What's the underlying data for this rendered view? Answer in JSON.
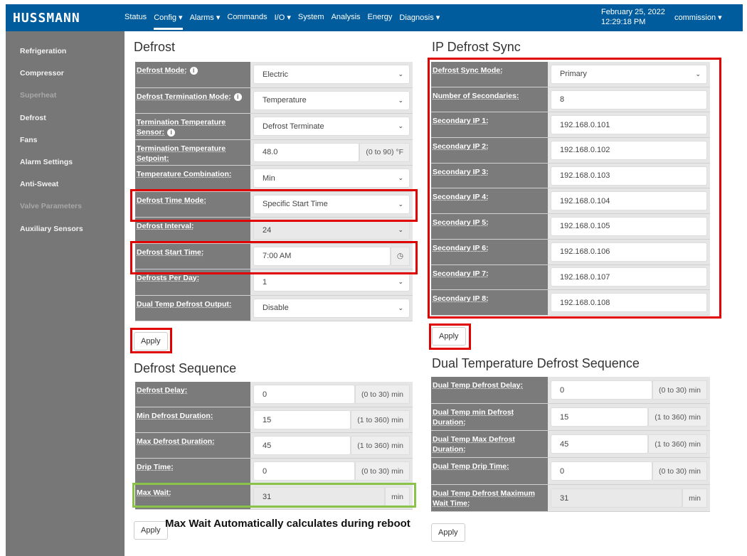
{
  "header": {
    "logo": "HUSSMANN",
    "nav": [
      "Status",
      "Config ▾",
      "Alarms ▾",
      "Commands",
      "I/O ▾",
      "System",
      "Analysis",
      "Energy",
      "Diagnosis ▾"
    ],
    "date": "February 25, 2022",
    "time": "12:29:18 PM",
    "user": "commission ▾"
  },
  "sidebar": [
    {
      "label": "Refrigeration",
      "disabled": false
    },
    {
      "label": "Compressor",
      "disabled": false
    },
    {
      "label": "Superheat",
      "disabled": true
    },
    {
      "label": "Defrost",
      "disabled": false
    },
    {
      "label": "Fans",
      "disabled": false
    },
    {
      "label": "Alarm Settings",
      "disabled": false
    },
    {
      "label": "Anti-Sweat",
      "disabled": false
    },
    {
      "label": "Valve Parameters",
      "disabled": true
    },
    {
      "label": "Auxiliary Sensors",
      "disabled": false
    }
  ],
  "defrost": {
    "title": "Defrost",
    "apply": "Apply",
    "rows": [
      {
        "label": "Defrost Mode:",
        "info": true,
        "value": "Electric",
        "type": "select"
      },
      {
        "label": "Defrost Termination Mode:",
        "info": true,
        "value": "Temperature",
        "type": "select"
      },
      {
        "label": "Termination Temperature Sensor:",
        "info": true,
        "value": "Defrost Terminate",
        "type": "select"
      },
      {
        "label": "Termination Temperature Setpoint:",
        "value": "48.0",
        "type": "input",
        "unit": "(0 to 90) °F"
      },
      {
        "label": "Temperature Combination:",
        "value": "Min",
        "type": "select"
      },
      {
        "label": "Defrost Time Mode:",
        "value": "Specific Start Time",
        "type": "select"
      },
      {
        "label": "Defrost Interval:",
        "value": "24",
        "type": "select",
        "readonly": true
      },
      {
        "label": "Defrost Start Time:",
        "value": "7:00 AM",
        "type": "time",
        "unit": "◷"
      },
      {
        "label": "Defrosts Per Day:",
        "value": "1",
        "type": "select"
      },
      {
        "label": "Dual Temp Defrost Output:",
        "value": "Disable",
        "type": "select"
      }
    ]
  },
  "ipsync": {
    "title": "IP Defrost Sync",
    "apply": "Apply",
    "rows": [
      {
        "label": "Defrost Sync Mode:",
        "value": "Primary",
        "type": "select"
      },
      {
        "label": "Number of Secondaries:",
        "value": "8",
        "type": "input"
      },
      {
        "label": "Secondary IP 1:",
        "value": "192.168.0.101",
        "type": "input"
      },
      {
        "label": "Secondary IP 2:",
        "value": "192.168.0.102",
        "type": "input"
      },
      {
        "label": "Secondary IP 3:",
        "value": "192.168.0.103",
        "type": "input"
      },
      {
        "label": "Secondary IP 4:",
        "value": "192.168.0.104",
        "type": "input"
      },
      {
        "label": "Secondary IP 5:",
        "value": "192.168.0.105",
        "type": "input"
      },
      {
        "label": "Secondary IP 6:",
        "value": "192.168.0.106",
        "type": "input"
      },
      {
        "label": "Secondary IP 7:",
        "value": "192.168.0.107",
        "type": "input"
      },
      {
        "label": "Secondary IP 8:",
        "value": "192.168.0.108",
        "type": "input"
      }
    ]
  },
  "sequence": {
    "title": "Defrost Sequence",
    "apply": "Apply",
    "rows": [
      {
        "label": "Defrost Delay:",
        "value": "0",
        "type": "input",
        "unit": "(0 to 30) min"
      },
      {
        "label": "Min Defrost Duration:",
        "value": "15",
        "type": "input",
        "unit": "(1 to 360) min"
      },
      {
        "label": "Max Defrost Duration:",
        "value": "45",
        "type": "input",
        "unit": "(1 to 360) min"
      },
      {
        "label": "Drip Time:",
        "value": "0",
        "type": "input",
        "unit": "(0 to 30) min"
      },
      {
        "label": "Max Wait:",
        "value": "31",
        "type": "input",
        "unit": "min",
        "readonly": true
      }
    ]
  },
  "dual": {
    "title": "Dual Temperature Defrost Sequence",
    "apply": "Apply",
    "rows": [
      {
        "label": "Dual Temp Defrost Delay:",
        "value": "0",
        "type": "input",
        "unit": "(0 to 30) min"
      },
      {
        "label": "Dual Temp min Defrost Duration:",
        "value": "15",
        "type": "input",
        "unit": "(1 to 360) min"
      },
      {
        "label": "Dual Temp Max Defrost Duration:",
        "value": "45",
        "type": "input",
        "unit": "(1 to 360) min"
      },
      {
        "label": "Dual Temp Drip Time:",
        "value": "0",
        "type": "input",
        "unit": "(0 to 30) min"
      },
      {
        "label": "Dual Temp Defrost Maximum Wait Time:",
        "value": "31",
        "type": "input",
        "unit": "min",
        "readonly": true
      }
    ]
  },
  "annotation": "Max Wait Automatically calculates during reboot",
  "colors": {
    "header": "#005c9c",
    "highlight": "#e00000",
    "green": "#8bc34a"
  }
}
